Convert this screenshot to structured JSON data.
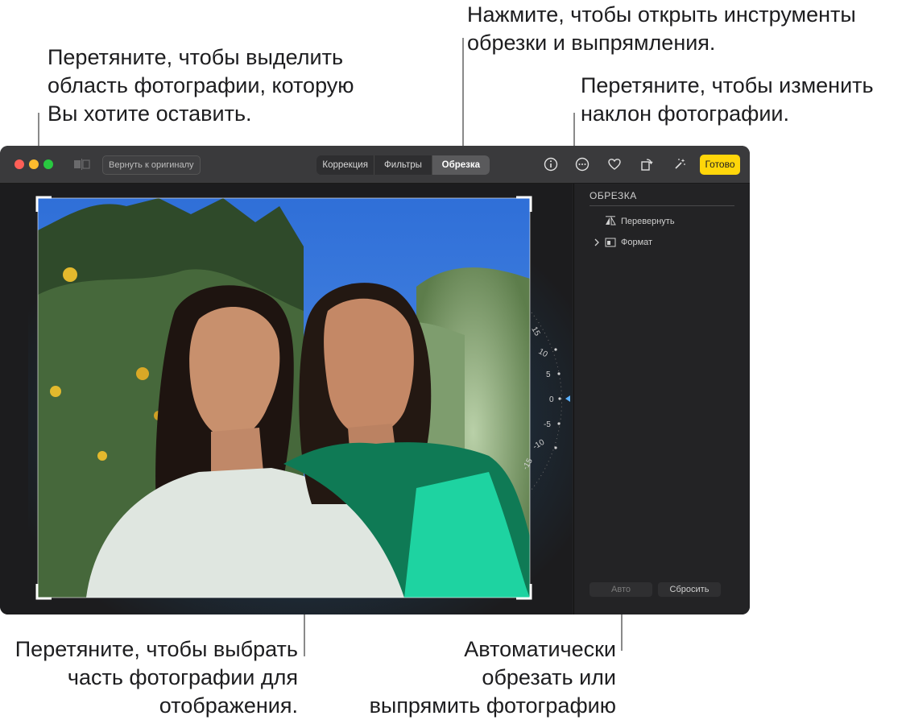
{
  "callouts": {
    "crop_area": "Перетяните, чтобы выделить\nобласть фотографии, которую\nВы хотите оставить.",
    "crop_tools": "Нажмите, чтобы открыть инструменты\nобрезки и выпрямления.",
    "tilt": "Перетяните, чтобы изменить\nнаклон фотографии.",
    "pan": "Перетяните, чтобы выбрать\nчасть фотографии для\nотображения.",
    "auto": "Автоматически\nобрезать или\nвыпрямить фотографию"
  },
  "toolbar": {
    "revert_label": "Вернуть к оригиналу",
    "tabs": [
      "Коррекция",
      "Фильтры",
      "Обрезка"
    ],
    "active_tab": "Обрезка",
    "icons": [
      "info-icon",
      "more-icon",
      "heart-icon",
      "rotate-icon",
      "magic-wand-icon"
    ],
    "done_label": "Готово",
    "done_color": "#ffd60a"
  },
  "sidebar": {
    "title": "ОБРЕЗКА",
    "flip_label": "Перевернуть",
    "format_label": "Формат",
    "auto_label": "Авто",
    "reset_label": "Сбросить"
  },
  "dial": {
    "labels": [
      "15",
      "10",
      "5",
      "0",
      "-5",
      "-10",
      "-15"
    ],
    "current_value": 0
  }
}
